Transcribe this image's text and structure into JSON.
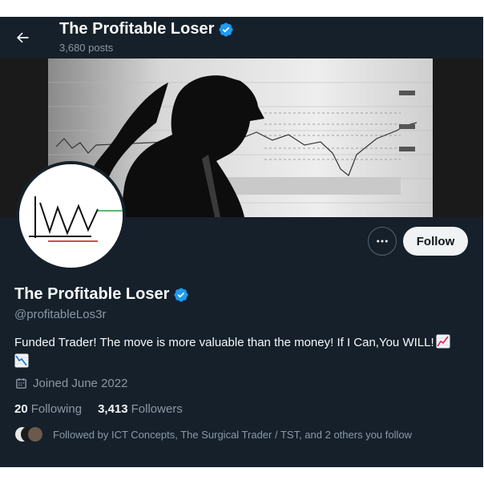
{
  "header": {
    "title": "The Profitable Loser",
    "post_count": "3,680 posts"
  },
  "profile": {
    "display_name": "The Profitable Loser",
    "handle": "@profitableLos3r",
    "bio": "Funded Trader! The move is more valuable than the money! If I Can,You WILL!",
    "joined": "Joined June 2022",
    "following_count": "20",
    "following_label": "Following",
    "followers_count": "3,413",
    "followers_label": "Followers",
    "followed_by": "Followed by ICT Concepts, The Surgical Trader / TST, and 2 others you follow"
  },
  "actions": {
    "follow_label": "Follow"
  },
  "icons": {
    "back": "arrow-left-icon",
    "verified": "verified-badge-icon",
    "more": "more-horizontal-icon",
    "calendar": "calendar-icon",
    "bio_emoji_1": "chart-increasing-emoji",
    "bio_emoji_2": "chart-decreasing-emoji"
  },
  "colors": {
    "background": "#15202b",
    "verified": "#1d9bf0",
    "secondary_text": "#8b98a5",
    "primary_text": "#f7f9f9",
    "follow_button_bg": "#eff3f4"
  }
}
